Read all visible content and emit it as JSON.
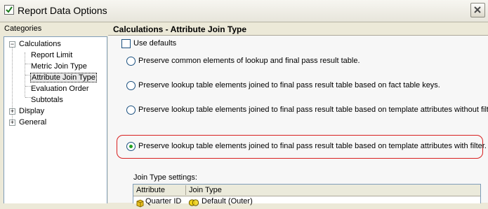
{
  "window": {
    "title": "Report Data Options",
    "icon": "checkmark-icon",
    "close_icon": "close-icon"
  },
  "categories": {
    "label": "Categories",
    "tree": [
      {
        "label": "Calculations",
        "expanded": true,
        "children": [
          "Report Limit",
          "Metric Join Type",
          "Attribute Join Type",
          "Evaluation Order",
          "Subtotals"
        ]
      },
      {
        "label": "Display",
        "expanded": false
      },
      {
        "label": "General",
        "expanded": false
      }
    ],
    "selected": "Attribute Join Type"
  },
  "panel": {
    "title": "Calculations - Attribute Join Type",
    "use_defaults_label": "Use defaults",
    "use_defaults_checked": false,
    "options": [
      "Preserve common elements of lookup and final pass result table.",
      "Preserve lookup table elements joined to final pass result table based on fact table keys.",
      "Preserve lookup table elements joined to final pass result table based on template attributes without filter.",
      "Preserve lookup table elements joined to final pass result table based on template attributes with filter."
    ],
    "selected_option": 3,
    "join_settings": {
      "label": "Join Type settings:",
      "columns": [
        "Attribute",
        "Join Type"
      ],
      "rows": [
        {
          "attribute": "Quarter ID",
          "join_type": "Default (Outer)"
        }
      ]
    }
  }
}
